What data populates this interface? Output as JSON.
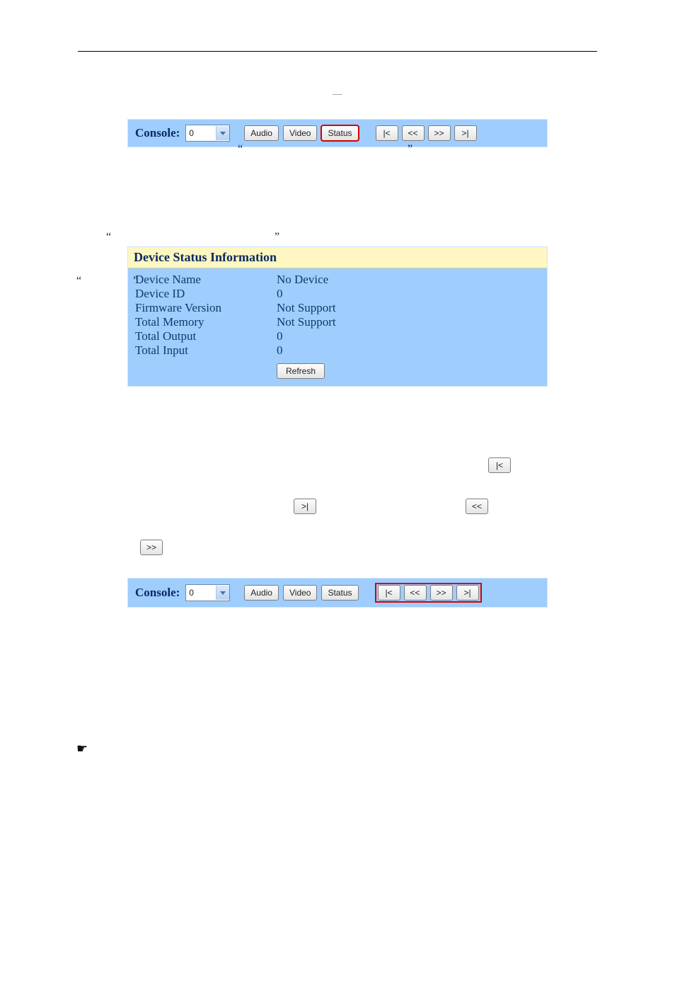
{
  "page": {
    "rule_marker": "--"
  },
  "punct": {
    "open": "“",
    "close": "”"
  },
  "toolbar": {
    "console_label": "Console:",
    "console_value": "0",
    "audio": "Audio",
    "video": "Video",
    "status": "Status",
    "first": "|<",
    "prev": "<<",
    "next": ">>",
    "last": ">|"
  },
  "device": {
    "header": "Device Status Information",
    "rows": [
      {
        "k": "Device Name",
        "v": "No Device"
      },
      {
        "k": "Device ID",
        "v": "0"
      },
      {
        "k": "Firmware Version",
        "v": "Not Support"
      },
      {
        "k": "Total Memory",
        "v": "Not Support"
      },
      {
        "k": "Total Output",
        "v": "0"
      },
      {
        "k": "Total Input",
        "v": "0"
      }
    ],
    "refresh": "Refresh"
  },
  "inline_nav": {
    "first": "|<",
    "last": ">|",
    "prev": "<<",
    "next": ">>"
  },
  "pointer": "☛"
}
